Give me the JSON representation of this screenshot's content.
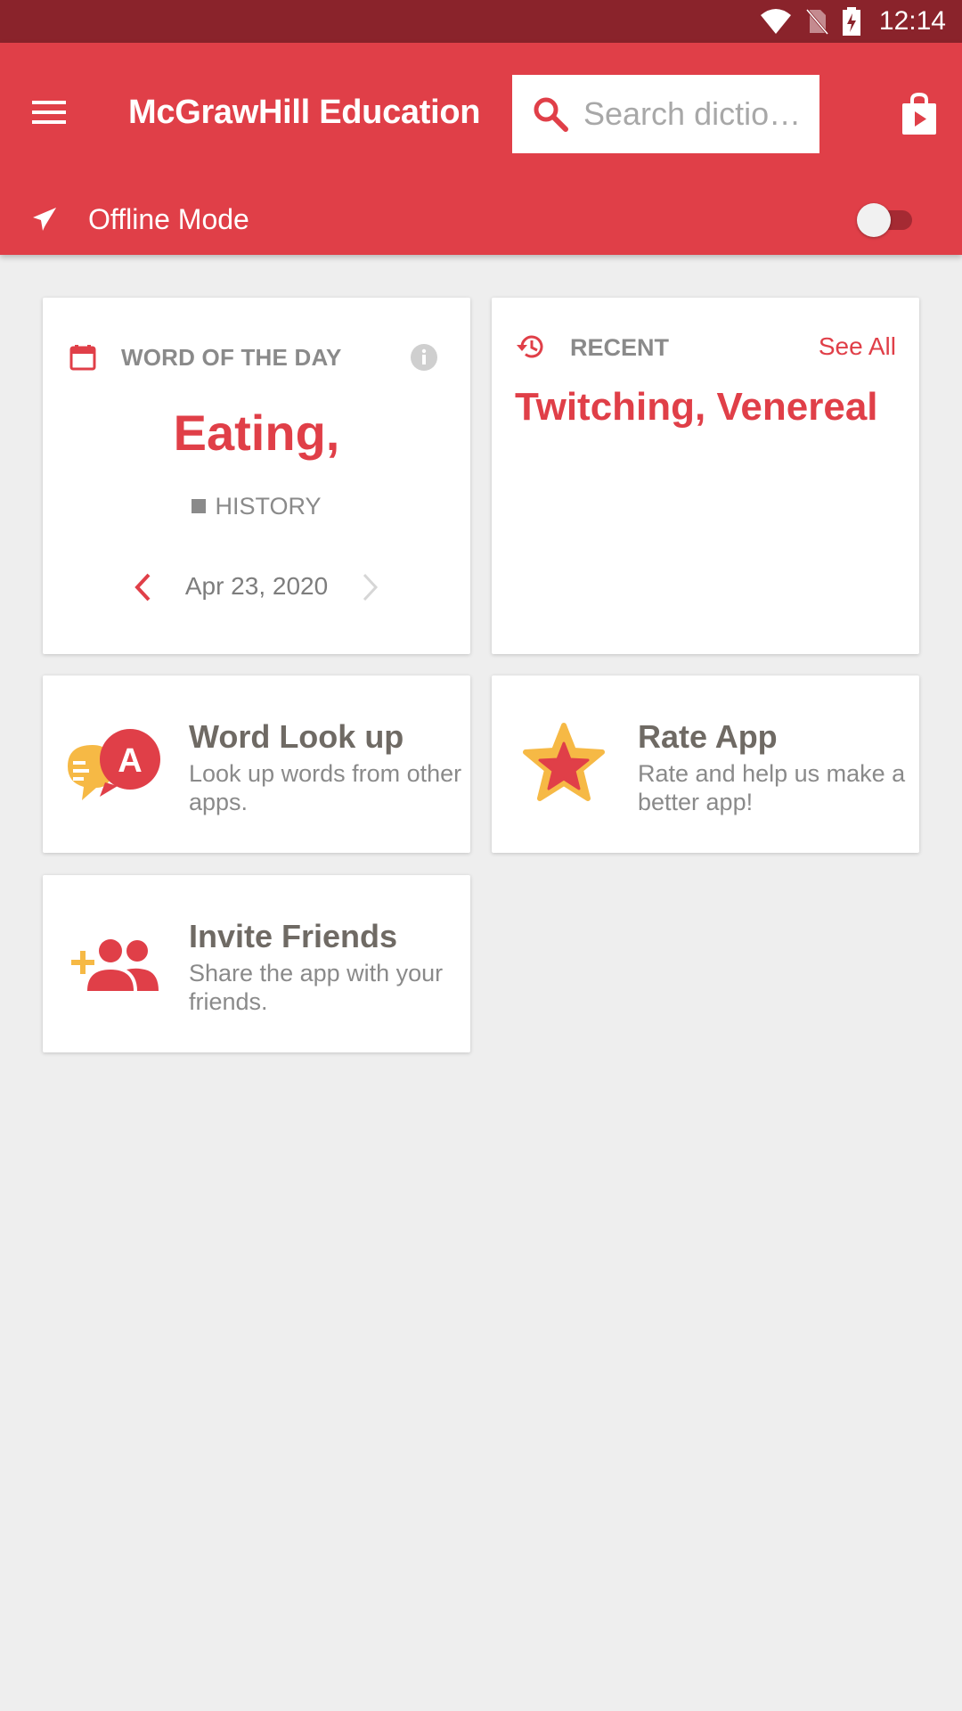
{
  "status_bar": {
    "time": "12:14",
    "icons": [
      "wifi-icon",
      "no-sim-icon",
      "battery-charging-icon"
    ]
  },
  "app_bar": {
    "title": "McGrawHill Education",
    "search_placeholder": "Search dictio…",
    "offline_label": "Offline Mode",
    "offline_enabled": false,
    "colors": {
      "primary": "#e03f48",
      "status_bar": "#8a232b",
      "toggle_track": "#a52a33"
    }
  },
  "word_of_the_day": {
    "label": "WORD OF THE DAY",
    "word": "Eating,",
    "category": "HISTORY",
    "date": "Apr 23, 2020"
  },
  "recent": {
    "label": "RECENT",
    "see_all": "See All",
    "words": "Twitching, Venereal"
  },
  "features": {
    "lookup": {
      "title": "Word Look up",
      "description": "Look up words from other apps."
    },
    "rate": {
      "title": "Rate App",
      "description": "Rate and help us make a better app!"
    },
    "invite": {
      "title": "Invite Friends",
      "description": "Share the app with your friends."
    }
  },
  "accent_colors": {
    "red": "#e03f48",
    "yellow": "#f6b945",
    "gray_text": "#8a8a8a"
  }
}
